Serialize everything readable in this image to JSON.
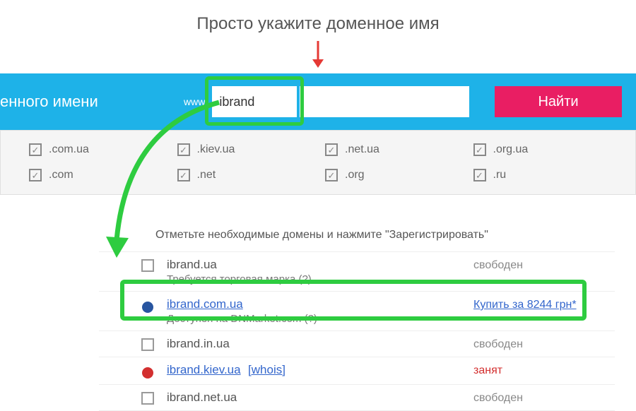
{
  "instruction": "Просто укажите доменное имя",
  "search": {
    "partial_label": "енного имени",
    "www": "www",
    "input_value": "ibrand",
    "find_btn": "Найти"
  },
  "tlds": [
    ".com.ua",
    ".kiev.ua",
    ".net.ua",
    ".org.ua",
    ".com",
    ".net",
    ".org",
    ".ru"
  ],
  "results": {
    "hint": "Отметьте необходимые домены и нажмите \"Зарегистрировать\"",
    "rows": [
      {
        "domain": "ibrand.ua",
        "sub": "Требуется торговая марка (?)",
        "status_text": "свободен",
        "status_class": "st-free",
        "marker": "check",
        "link": false
      },
      {
        "domain": "ibrand.com.ua",
        "sub": "Доступен на DNMarket.com (?)",
        "status_text": "Купить за 8244 грн*",
        "status_class": "st-buy",
        "marker": "dot-blue",
        "link": true
      },
      {
        "domain": "ibrand.in.ua",
        "sub": "",
        "status_text": "свободен",
        "status_class": "st-free",
        "marker": "check",
        "link": false
      },
      {
        "domain": "ibrand.kiev.ua",
        "sub": "",
        "whois": "[whois]",
        "status_text": "занят",
        "status_class": "st-busy",
        "marker": "dot-red",
        "link": true
      },
      {
        "domain": "ibrand.net.ua",
        "sub": "",
        "status_text": "свободен",
        "status_class": "st-free",
        "marker": "check",
        "link": false
      }
    ]
  }
}
